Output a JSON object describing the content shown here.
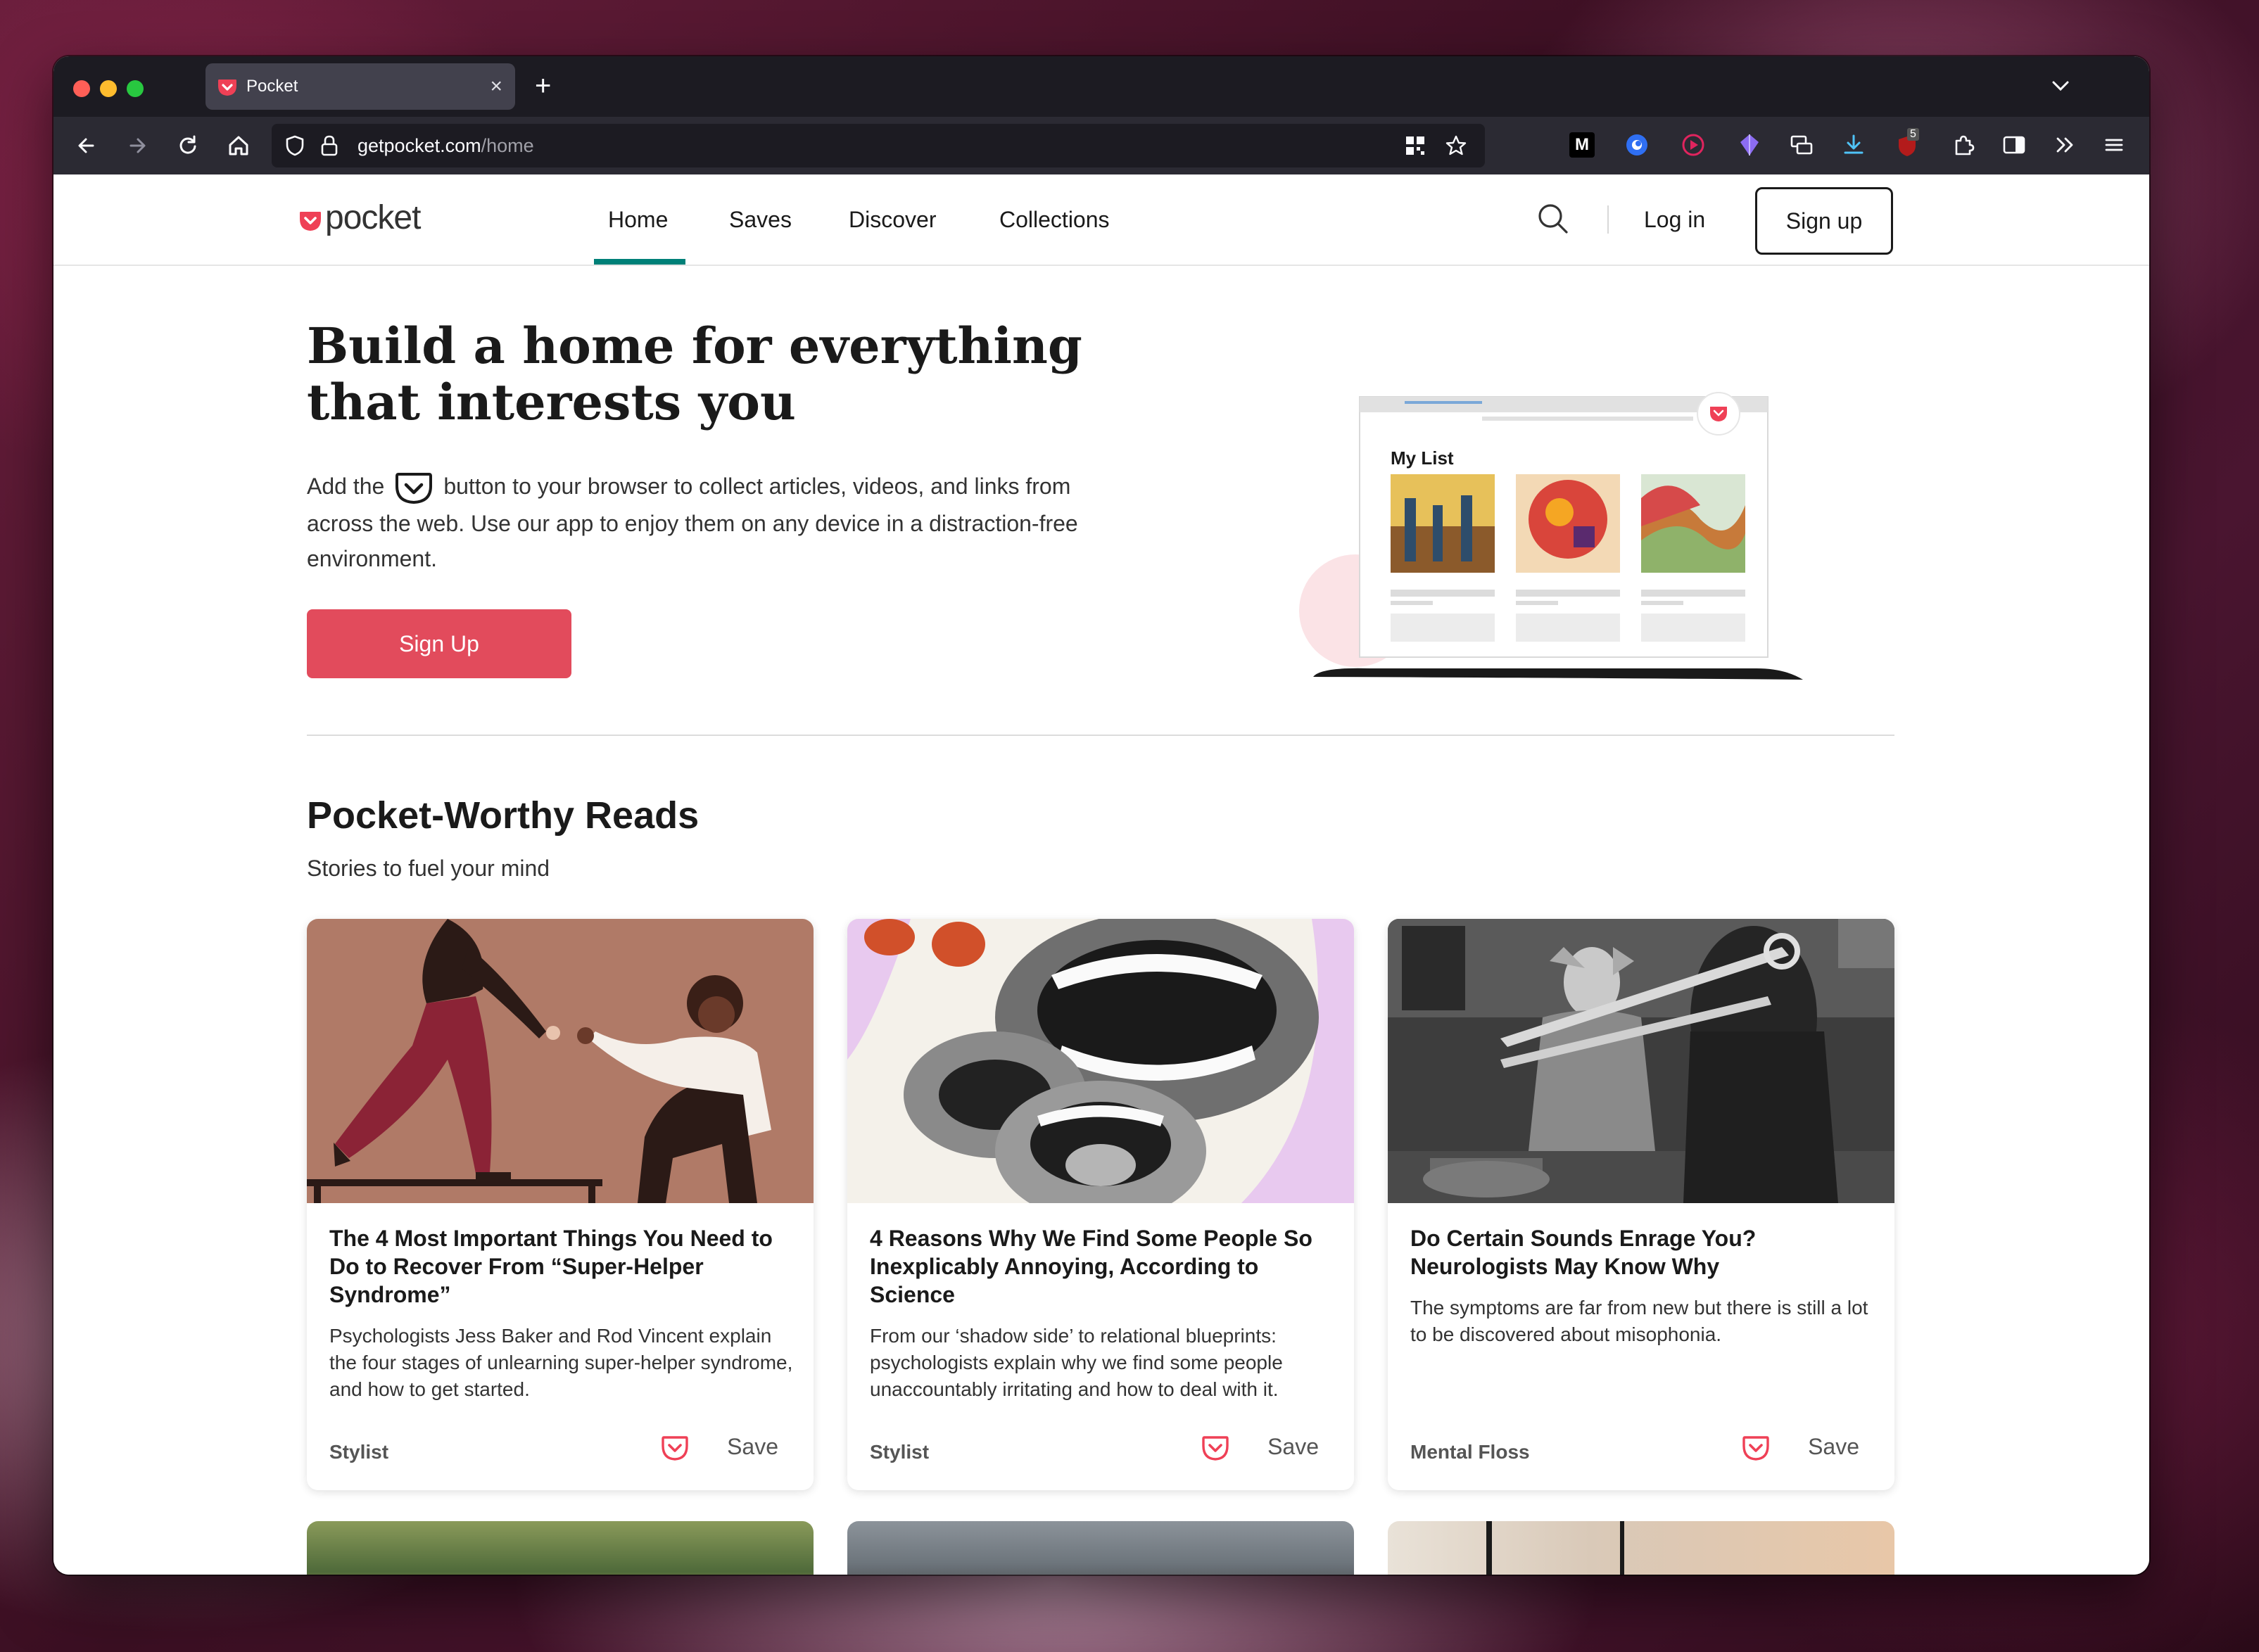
{
  "browser": {
    "tab_title": "Pocket",
    "url_host": "getpocket.com",
    "url_path": "/home",
    "extension_badge": "5"
  },
  "header": {
    "logo_text": "pocket",
    "nav": [
      "Home",
      "Saves",
      "Discover",
      "Collections"
    ],
    "active_nav": "Home",
    "login_label": "Log in",
    "signup_label": "Sign up"
  },
  "hero": {
    "title_line1": "Build a home for everything",
    "title_line2": "that interests you",
    "text_before_icon": "Add the",
    "text_after_icon": "button to your browser to collect articles, videos, and links from across the web. Use our app to enjoy them on any device in a distraction-free environment.",
    "cta_label": "Sign Up",
    "illustration_label": "My List"
  },
  "section": {
    "title": "Pocket-Worthy Reads",
    "subtitle": "Stories to fuel your mind"
  },
  "cards": [
    {
      "title": "The 4 Most Important Things You Need to Do to Recover From “Super-Helper Syndrome”",
      "excerpt": "Psychologists Jess Baker and Rod Vincent explain the four stages of unlearning super-helper syndrome, and how to get started.",
      "source": "Stylist",
      "save_label": "Save"
    },
    {
      "title": "4 Reasons Why We Find Some People So Inexplicably Annoying, According to Science",
      "excerpt": "From our ‘shadow side’ to relational blueprints: psychologists explain why we find some people unaccountably irritating and how to deal with it.",
      "source": "Stylist",
      "save_label": "Save"
    },
    {
      "title": "Do Certain Sounds Enrage You? Neurologists May Know Why",
      "excerpt": "The symptoms are far from new but there is still a lot to be discovered about misophonia.",
      "source": "Mental Floss",
      "save_label": "Save"
    }
  ],
  "colors": {
    "brand_red": "#e24b5c",
    "accent_teal": "#008078",
    "toolbar_bg": "#2b2a33",
    "tabstrip_bg": "#1c1b22"
  }
}
